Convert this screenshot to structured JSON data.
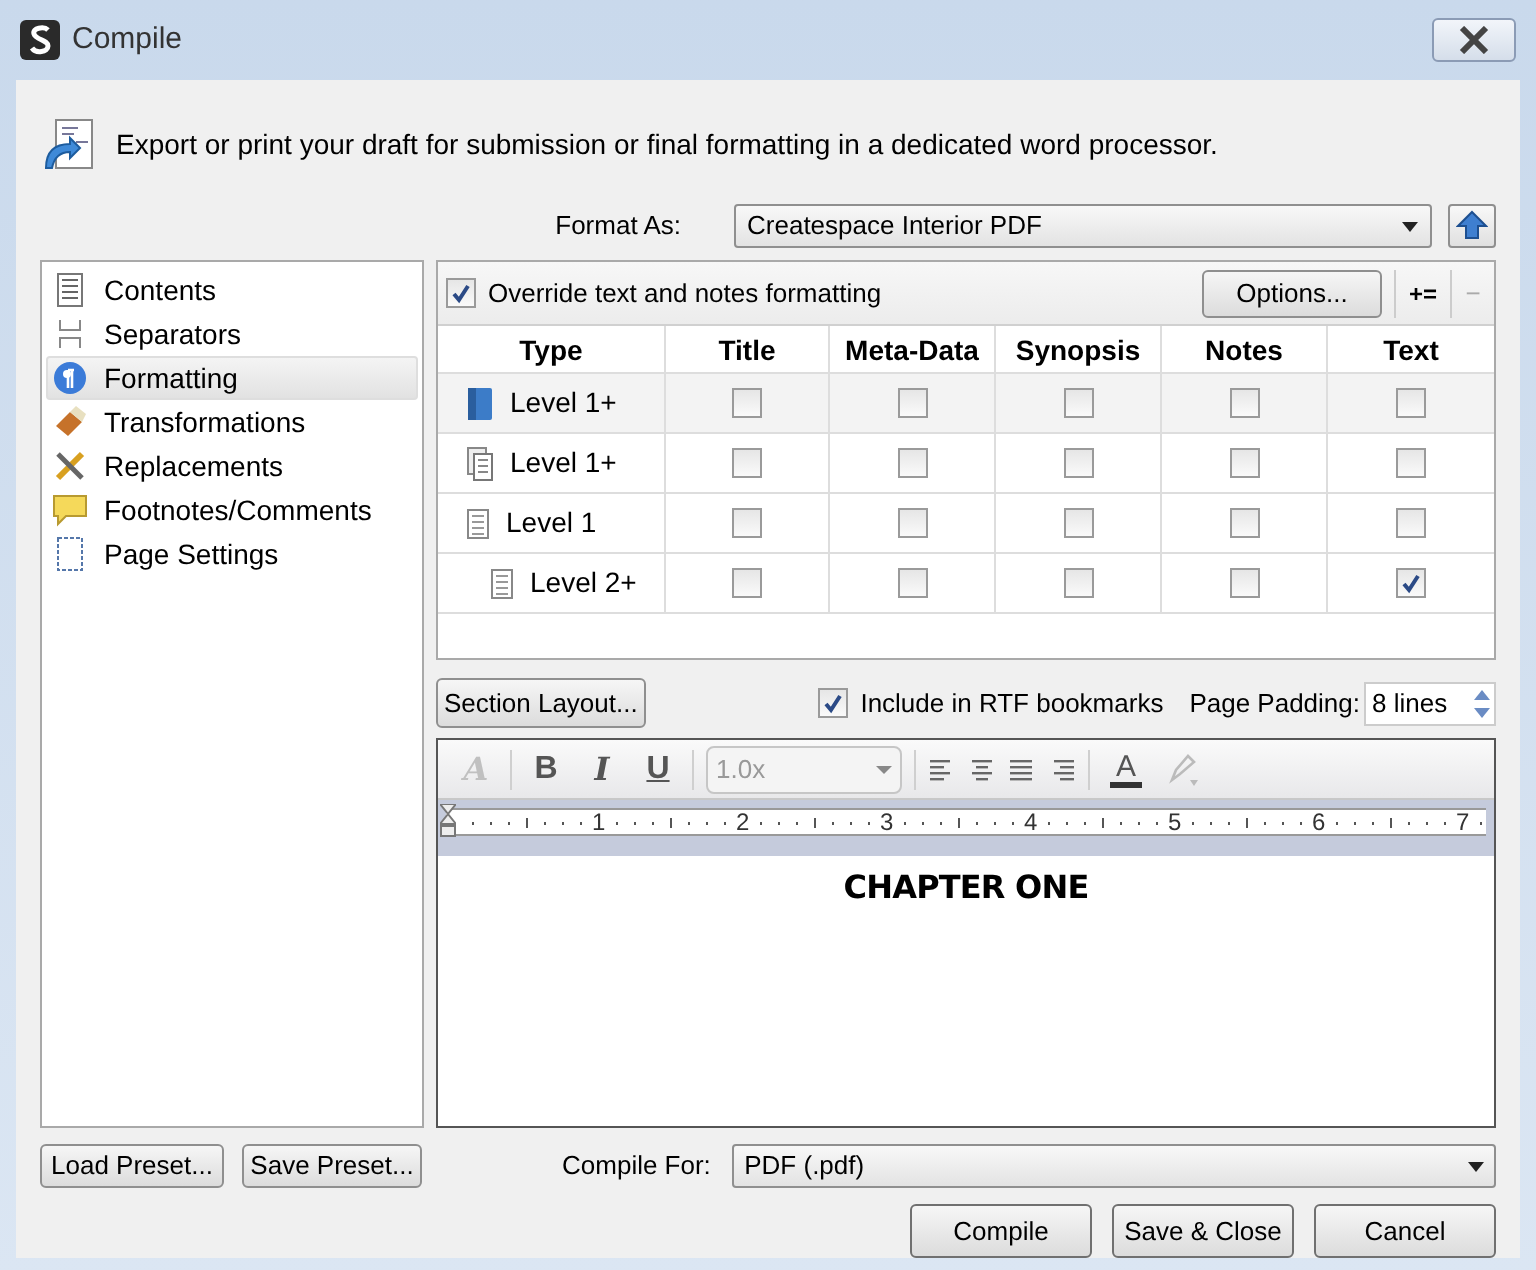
{
  "window": {
    "title": "Compile"
  },
  "description": "Export or print your draft for submission or final formatting in a dedicated word processor.",
  "format_as": {
    "label": "Format As:",
    "value": "Createspace Interior PDF"
  },
  "sidebar": {
    "items": [
      {
        "label": "Contents",
        "selected": false
      },
      {
        "label": "Separators",
        "selected": false
      },
      {
        "label": "Formatting",
        "selected": true
      },
      {
        "label": "Transformations",
        "selected": false
      },
      {
        "label": "Replacements",
        "selected": false
      },
      {
        "label": "Footnotes/Comments",
        "selected": false
      },
      {
        "label": "Page Settings",
        "selected": false
      }
    ]
  },
  "override": {
    "label": "Override text and notes formatting",
    "checked": true
  },
  "options_button": "Options...",
  "add_button": "+=",
  "remove_button": "−",
  "table": {
    "columns": [
      "Type",
      "Title",
      "Meta-Data",
      "Synopsis",
      "Notes",
      "Text"
    ],
    "rows": [
      {
        "label": "Level 1+",
        "indented": false,
        "selected": true,
        "checks": [
          false,
          false,
          false,
          false,
          false
        ]
      },
      {
        "label": "Level 1+",
        "indented": false,
        "selected": false,
        "checks": [
          false,
          false,
          false,
          false,
          false
        ]
      },
      {
        "label": "Level 1",
        "indented": false,
        "selected": false,
        "checks": [
          false,
          false,
          false,
          false,
          false
        ]
      },
      {
        "label": "Level 2+",
        "indented": true,
        "selected": false,
        "checks": [
          false,
          false,
          false,
          false,
          true
        ]
      }
    ]
  },
  "section_layout_button": "Section Layout...",
  "rtf_bookmarks": {
    "label": "Include in RTF bookmarks",
    "checked": true
  },
  "page_padding": {
    "label": "Page Padding:",
    "value": "8 lines"
  },
  "toolbar": {
    "clear_format": {
      "text": "A",
      "disabled": true
    },
    "bold": "B",
    "italic": "I",
    "underline": "U",
    "line_spacing": "1.0x",
    "text_color": "A",
    "highlight": {
      "disabled": true
    }
  },
  "ruler": [
    "1",
    "2",
    "3",
    "4",
    "5",
    "6",
    "7"
  ],
  "editor_text": "CHAPTER ONE",
  "load_preset_button": "Load Preset...",
  "save_preset_button": "Save Preset...",
  "compile_for": {
    "label": "Compile For:",
    "value": "PDF (.pdf)"
  },
  "buttons": [
    "Compile",
    "Save & Close",
    "Cancel"
  ]
}
